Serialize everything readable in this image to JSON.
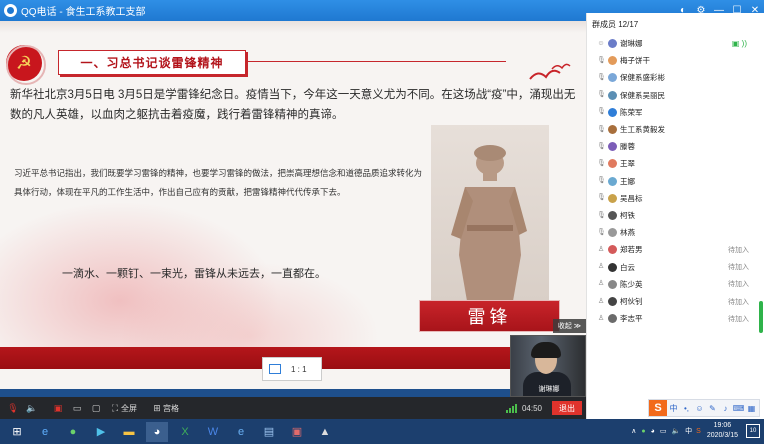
{
  "window": {
    "title": "QQ电话 - 食生工系教工支部"
  },
  "slide": {
    "heading": "一、习总书记谈雷锋精神",
    "lead": "新华社北京3月5日电 3月5日是学雷锋纪念日。疫情当下，今年这一天意义尤为不同。在这场战“疫”中，涌现出无数的凡人英雄，以血肉之躯抗击着疫魔，践行着雷锋精神的真谛。",
    "quote": "习近平总书记指出，我们既要学习雷锋的精神，也要学习雷锋的做法，把崇高理想信念和道德品质追求转化为具体行动，体现在平凡的工作生活中，作出自己应有的贡献，把雷锋精神代代传承下去。",
    "motto": "一滴水、一颗钉、一束光，雷锋从未远去，一直都在。",
    "nameplate": "雷锋"
  },
  "overlay": {
    "collapse": "收起",
    "ratio": "1 : 1",
    "camera_name": "谢琳娜"
  },
  "bottombar": {
    "fullscreen": "全屏",
    "grid": "宫格",
    "duration": "04:50",
    "exit": "退出"
  },
  "panel": {
    "header": "群成员 12/17",
    "members": [
      {
        "name": "谢琳娜",
        "status": "",
        "speaking": true,
        "color": "#6b7cc8"
      },
      {
        "name": "梅子饼干",
        "status": "",
        "speaking": false,
        "color": "#e39b5a"
      },
      {
        "name": "保健系盛彩彬",
        "status": "",
        "speaking": false,
        "color": "#7aa7d8"
      },
      {
        "name": "保健系吴丽民",
        "status": "",
        "speaking": false,
        "color": "#5b8fb4"
      },
      {
        "name": "陈荣军",
        "status": "",
        "speaking": false,
        "color": "#2f7ed8"
      },
      {
        "name": "生工系黄毅发",
        "status": "",
        "speaking": false,
        "color": "#a86f3c"
      },
      {
        "name": "滕蓉",
        "status": "",
        "speaking": false,
        "color": "#7c5db8"
      },
      {
        "name": "王翠",
        "status": "",
        "speaking": false,
        "color": "#e07a5f"
      },
      {
        "name": "王娜",
        "status": "",
        "speaking": false,
        "color": "#6aa9d1"
      },
      {
        "name": "吴昌标",
        "status": "",
        "speaking": false,
        "color": "#c9a24a"
      },
      {
        "name": "柯铁",
        "status": "",
        "speaking": false,
        "color": "#555"
      },
      {
        "name": "林燕",
        "status": "",
        "speaking": false,
        "color": "#999"
      },
      {
        "name": "郑若男",
        "status": "待加入",
        "speaking": false,
        "color": "#d45a5a"
      },
      {
        "name": "白云",
        "status": "待加入",
        "speaking": false,
        "color": "#333"
      },
      {
        "name": "陈少英",
        "status": "待加入",
        "speaking": false,
        "color": "#888"
      },
      {
        "name": "柯伙钊",
        "status": "待加入",
        "speaking": false,
        "color": "#444"
      },
      {
        "name": "李志平",
        "status": "待加入",
        "speaking": false,
        "color": "#6b6b6b"
      }
    ]
  },
  "taskbar": {
    "time": "19:06",
    "date": "2020/3/15",
    "ime_lang": "中",
    "notifications": "10"
  }
}
